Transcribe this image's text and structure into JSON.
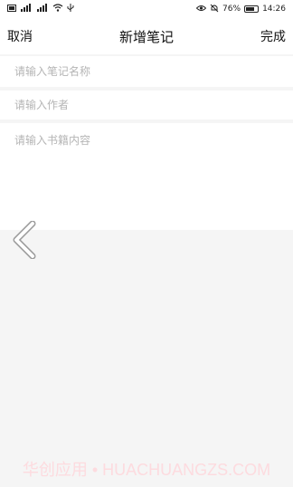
{
  "status_bar": {
    "left_icons": [
      "sim-card-icon",
      "signal-4g-icon",
      "signal-3g-icon",
      "wifi-icon",
      "usb-icon"
    ],
    "battery_percent": "76%",
    "battery_level": 0.76,
    "time": "14:26"
  },
  "nav": {
    "cancel_label": "取消",
    "title": "新增笔记",
    "done_label": "完成"
  },
  "form": {
    "name_placeholder": "请输入笔记名称",
    "author_placeholder": "请输入作者",
    "content_placeholder": "请输入书籍内容"
  },
  "watermark": {
    "text": "华创应用 • HUACHUANGZS.COM"
  },
  "colors": {
    "background": "#f5f5f5",
    "field_background": "#ffffff",
    "placeholder": "#b5b5b5",
    "watermark": "#ffd2d7"
  }
}
